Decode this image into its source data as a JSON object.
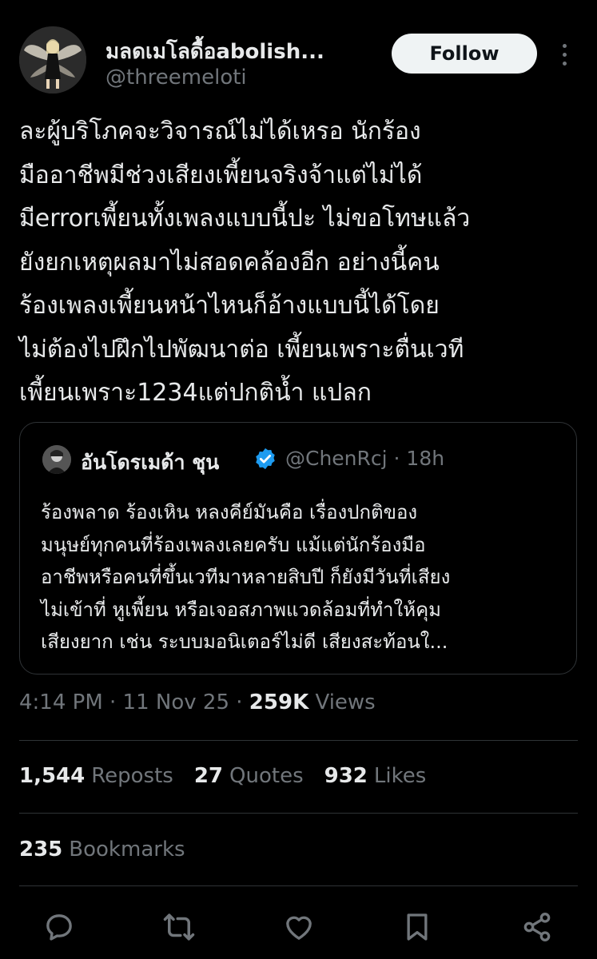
{
  "author": {
    "display_name": "มลดเมโลดื้อabolish...",
    "handle": "@threemeloti"
  },
  "follow_label": "Follow",
  "tweet_lines": [
    "ละผู้บริโภคจะวิจารณ์ไม่ได้เหรอ นักร้อง",
    "มืออาชีพมีช่วงเสียงเพี้ยนจริงจ้าแต่ไม่ได้",
    "มีerrorเพี้ยนทั้งเพลงแบบนี้ปะ ไม่ขอโทษแล้ว",
    "ยังยกเหตุผลมาไม่สอดคล้องอีก อย่างนี้คน",
    "ร้องเพลงเพี้ยนหน้าไหนก็อ้างแบบนี้ได้โดย",
    "ไม่ต้องไปฝึกไปพัฒนาต่อ เพี้ยนเพราะตื่นเวที",
    "เพี้ยนเพราะ1234แต่ปกติน้ำ แปลก"
  ],
  "quote": {
    "name": "อันโดรเมด้า ชุน",
    "handle_time": "@ChenRcj · 18h",
    "lines": [
      "ร้องพลาด ร้องเหิน หลงคีย์มันคือ เรื่องปกติของ",
      "มนุษย์ทุกคนที่ร้องเพลงเลยครับ แม้แต่นักร้องมือ",
      "อาชีพหรือคนที่ขึ้นเวทีมาหลายสิบปี ก็ยังมีวันที่เสียง",
      "ไม่เข้าที่ หูเพี้ยน หรือเจอสภาพแวดล้อมที่ทำให้คุม",
      "เสียงยาก เช่น ระบบมอนิเตอร์ไม่ดี เสียงสะท้อนใ..."
    ]
  },
  "timestamp": "4:14 PM · 11 Nov 25 · ",
  "views_count": "259K",
  "views_label": " Views",
  "stats": {
    "reposts_count": "1,544",
    "reposts_label": "Reposts",
    "quotes_count": "27",
    "quotes_label": "Quotes",
    "likes_count": "932",
    "likes_label": "Likes",
    "bookmarks_count": "235",
    "bookmarks_label": "Bookmarks"
  },
  "actions": [
    "reply-icon",
    "repost-icon",
    "like-icon",
    "bookmark-icon",
    "share-icon"
  ],
  "colors": {
    "background": "#000000",
    "text": "#e7e9ea",
    "muted": "#71767b",
    "verified": "#1d9bf0",
    "divider": "#2f3336"
  }
}
